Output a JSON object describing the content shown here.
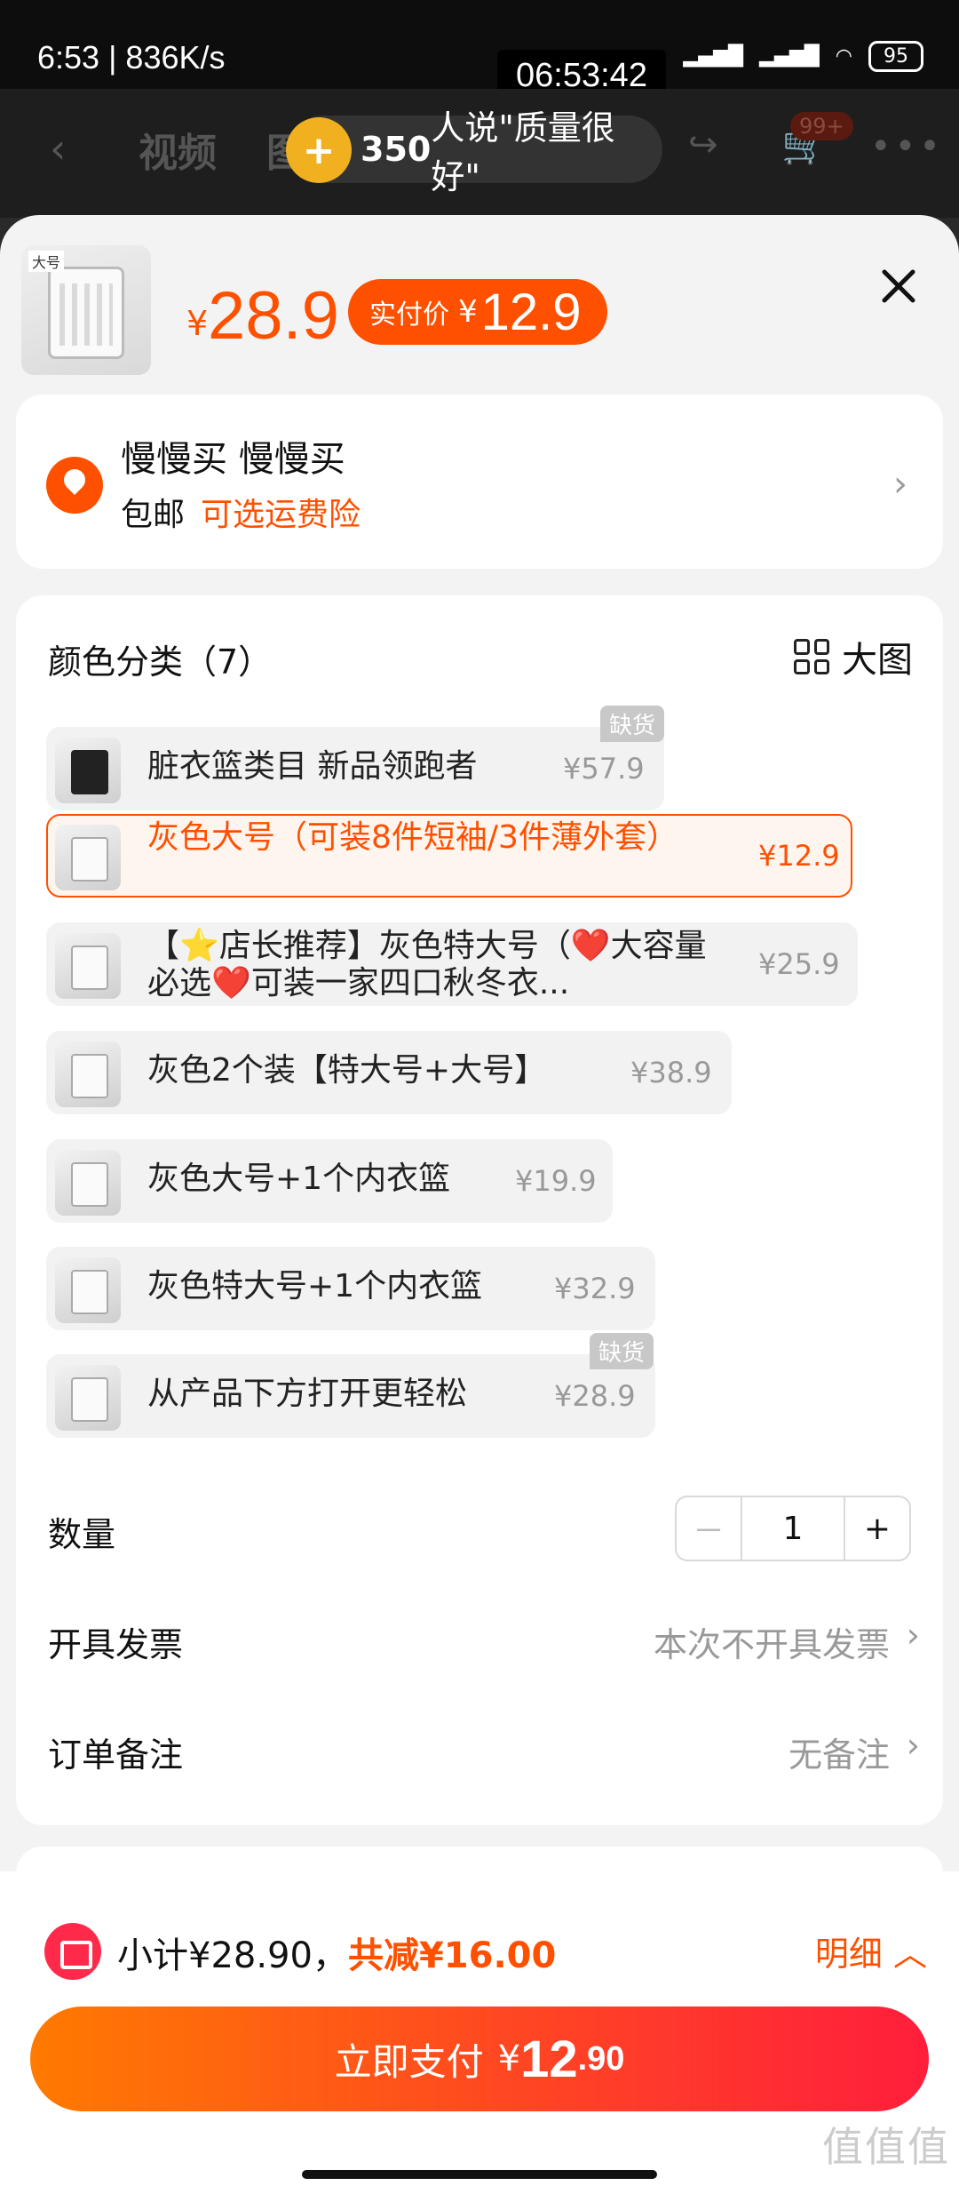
{
  "status_bar": {
    "left": "6:53 | 836K/s",
    "battery": "95",
    "clock_overlay": "06:53:42"
  },
  "app_header": {
    "tabs": [
      "视频",
      "图"
    ],
    "cart_badge": "99+",
    "review_count": "350",
    "review_text": "人说\"质量很好\""
  },
  "sku": {
    "price_symbol": "¥",
    "price": "28.9",
    "paid_label": "实付价",
    "paid_symbol": "¥",
    "paid_price": "12.9",
    "thumb_tag": "大号"
  },
  "address": {
    "name": "慢慢买 慢慢买",
    "shipping": "包邮",
    "shipping_option": "可选运费险"
  },
  "options": {
    "title": "颜色分类（7）",
    "big_image_label": "大图",
    "out_of_stock_label": "缺货",
    "items": [
      {
        "label": "脏衣篮类目 新品领跑者",
        "price": "¥57.9"
      },
      {
        "label": "灰色大号（可装8件短袖/3件薄外套）",
        "price": "¥12.9"
      },
      {
        "label": "【⭐店长推荐】灰色特大号（❤️大容量必选❤️可装一家四口秋冬衣...",
        "price": "¥25.9"
      },
      {
        "label": "灰色2个装【特大号+大号】",
        "price": "¥38.9"
      },
      {
        "label": "灰色大号+1个内衣篮",
        "price": "¥19.9"
      },
      {
        "label": "灰色特大号+1个内衣篮",
        "price": "¥32.9"
      },
      {
        "label": "从产品下方打开更轻松",
        "price": "¥28.9"
      }
    ]
  },
  "quantity": {
    "label": "数量",
    "minus": "－",
    "value": "1",
    "plus": "+"
  },
  "invoice": {
    "label": "开具发票",
    "value": "本次不开具发票"
  },
  "note": {
    "label": "订单备注",
    "value": "无备注"
  },
  "summary": {
    "subtotal": "小计¥28.90，",
    "discount": "共减¥16.00",
    "detail": "明细"
  },
  "pay": {
    "label": "立即支付",
    "symbol": "¥",
    "amount_int": "12",
    "amount_dec": ".90"
  },
  "watermark": "值值值",
  "colors": {
    "accent": "#ff5000",
    "coupon": "#ff2a4a"
  }
}
